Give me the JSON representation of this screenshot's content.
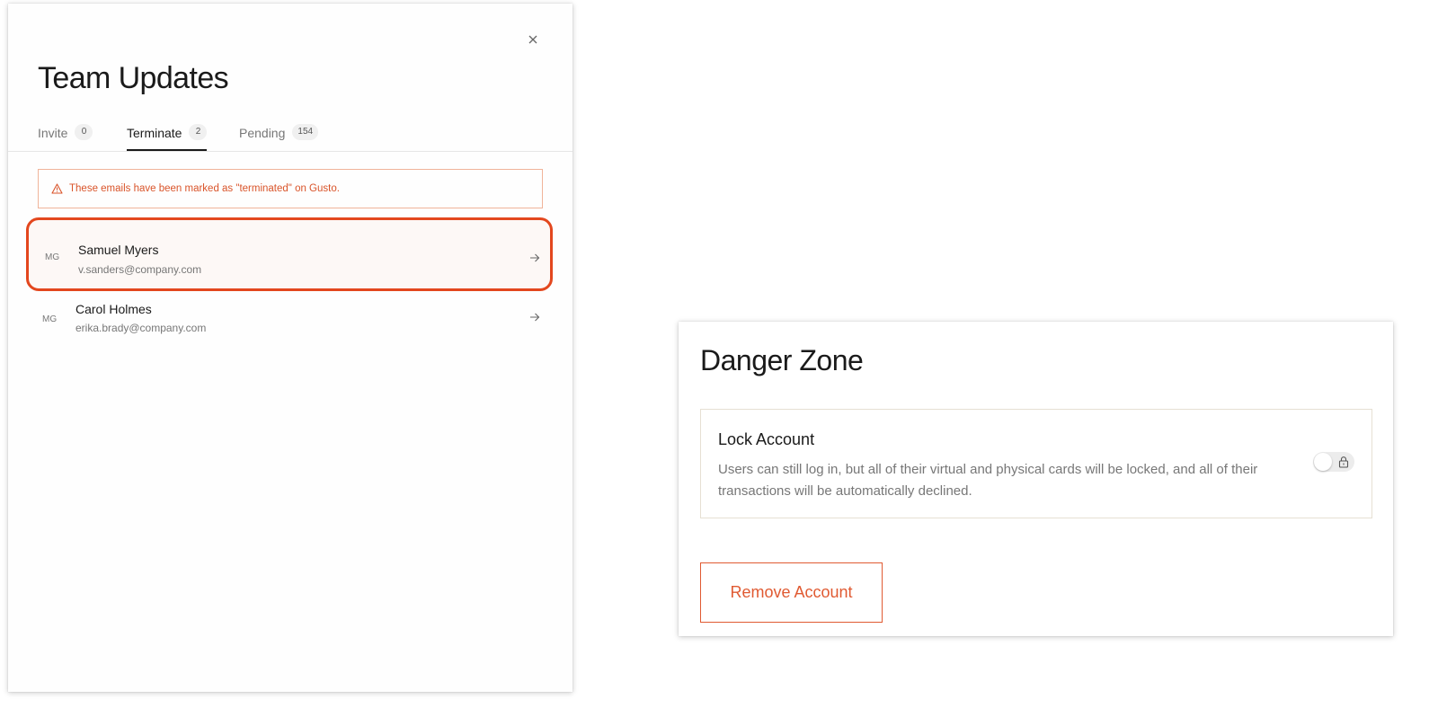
{
  "team_panel": {
    "title": "Team Updates",
    "close_icon": "close-icon",
    "tabs": [
      {
        "label": "Invite",
        "count": "0",
        "active": false
      },
      {
        "label": "Terminate",
        "count": "2",
        "active": true
      },
      {
        "label": "Pending",
        "count": "154",
        "active": false
      }
    ],
    "alert": {
      "icon": "warning-icon",
      "text": "These emails have been marked as \"terminated\" on Gusto.",
      "color": "#d9542a"
    },
    "employees": [
      {
        "initials": "MG",
        "name": "Samuel Myers",
        "email": "v.sanders@company.com",
        "highlighted": true
      },
      {
        "initials": "MG",
        "name": "Carol Holmes",
        "email": "erika.brady@company.com",
        "highlighted": false
      }
    ],
    "highlight_color": "#e3471e"
  },
  "danger_zone": {
    "title": "Danger Zone",
    "lock_account": {
      "title": "Lock Account",
      "description": "Users can still log in, but all of their virtual and physical cards will be locked, and all of their transactions will be automatically declined.",
      "toggle_on": false,
      "toggle_icon": "lock-icon"
    },
    "remove_button_label": "Remove Account",
    "accent_color": "#e05a32"
  }
}
